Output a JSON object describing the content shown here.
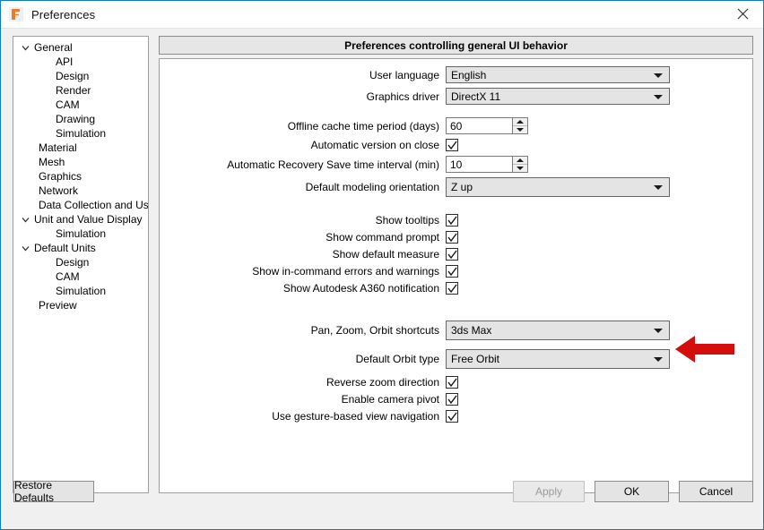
{
  "window": {
    "title": "Preferences",
    "logo_icon": "fusion360-logo-icon",
    "close_icon": "close-icon"
  },
  "sidebar": {
    "items": [
      {
        "label": "General",
        "depth": 0,
        "expanded": true
      },
      {
        "label": "API",
        "depth": 1,
        "expanded": null
      },
      {
        "label": "Design",
        "depth": 1,
        "expanded": null
      },
      {
        "label": "Render",
        "depth": 1,
        "expanded": null
      },
      {
        "label": "CAM",
        "depth": 1,
        "expanded": null
      },
      {
        "label": "Drawing",
        "depth": 1,
        "expanded": null
      },
      {
        "label": "Simulation",
        "depth": 1,
        "expanded": null
      },
      {
        "label": "Material",
        "depth": 0,
        "expanded": null
      },
      {
        "label": "Mesh",
        "depth": 0,
        "expanded": null
      },
      {
        "label": "Graphics",
        "depth": 0,
        "expanded": null
      },
      {
        "label": "Network",
        "depth": 0,
        "expanded": null
      },
      {
        "label": "Data Collection and Use",
        "depth": 0,
        "expanded": null
      },
      {
        "label": "Unit and Value Display",
        "depth": 0,
        "expanded": true
      },
      {
        "label": "Simulation",
        "depth": 1,
        "expanded": null
      },
      {
        "label": "Default Units",
        "depth": 0,
        "expanded": true
      },
      {
        "label": "Design",
        "depth": 1,
        "expanded": null
      },
      {
        "label": "CAM",
        "depth": 1,
        "expanded": null
      },
      {
        "label": "Simulation",
        "depth": 1,
        "expanded": null
      },
      {
        "label": "Preview",
        "depth": 0,
        "expanded": null
      }
    ]
  },
  "panel": {
    "header": "Preferences controlling general UI behavior",
    "fields": {
      "user_language": {
        "label": "User language",
        "value": "English"
      },
      "graphics_driver": {
        "label": "Graphics driver",
        "value": "DirectX 11"
      },
      "offline_cache": {
        "label": "Offline cache time period (days)",
        "value": "60"
      },
      "auto_version": {
        "label": "Automatic version on close",
        "checked": true
      },
      "auto_recovery": {
        "label": "Automatic Recovery Save time interval (min)",
        "value": "10"
      },
      "default_orientation": {
        "label": "Default modeling orientation",
        "value": "Z up"
      },
      "show_tooltips": {
        "label": "Show tooltips",
        "checked": true
      },
      "show_command_prompt": {
        "label": "Show command prompt",
        "checked": true
      },
      "show_default_measure": {
        "label": "Show default measure",
        "checked": true
      },
      "show_incommand_errors": {
        "label": "Show in-command errors and warnings",
        "checked": true
      },
      "show_a360_notification": {
        "label": "Show Autodesk A360 notification",
        "checked": true
      },
      "pan_zoom_orbit": {
        "label": "Pan, Zoom, Orbit shortcuts",
        "value": "3ds Max"
      },
      "default_orbit_type": {
        "label": "Default Orbit type",
        "value": "Free Orbit"
      },
      "reverse_zoom": {
        "label": "Reverse zoom direction",
        "checked": true
      },
      "enable_camera_pivot": {
        "label": "Enable camera pivot",
        "checked": true
      },
      "gesture_navigation": {
        "label": "Use gesture-based view navigation",
        "checked": true
      }
    }
  },
  "annotation": {
    "arrow_icon": "red-left-arrow-icon",
    "color": "#d40d0d",
    "points_at": "Pan, Zoom, Orbit shortcuts"
  },
  "footer": {
    "restore_defaults": "Restore Defaults",
    "apply": "Apply",
    "apply_enabled": false,
    "ok": "OK",
    "cancel": "Cancel"
  }
}
